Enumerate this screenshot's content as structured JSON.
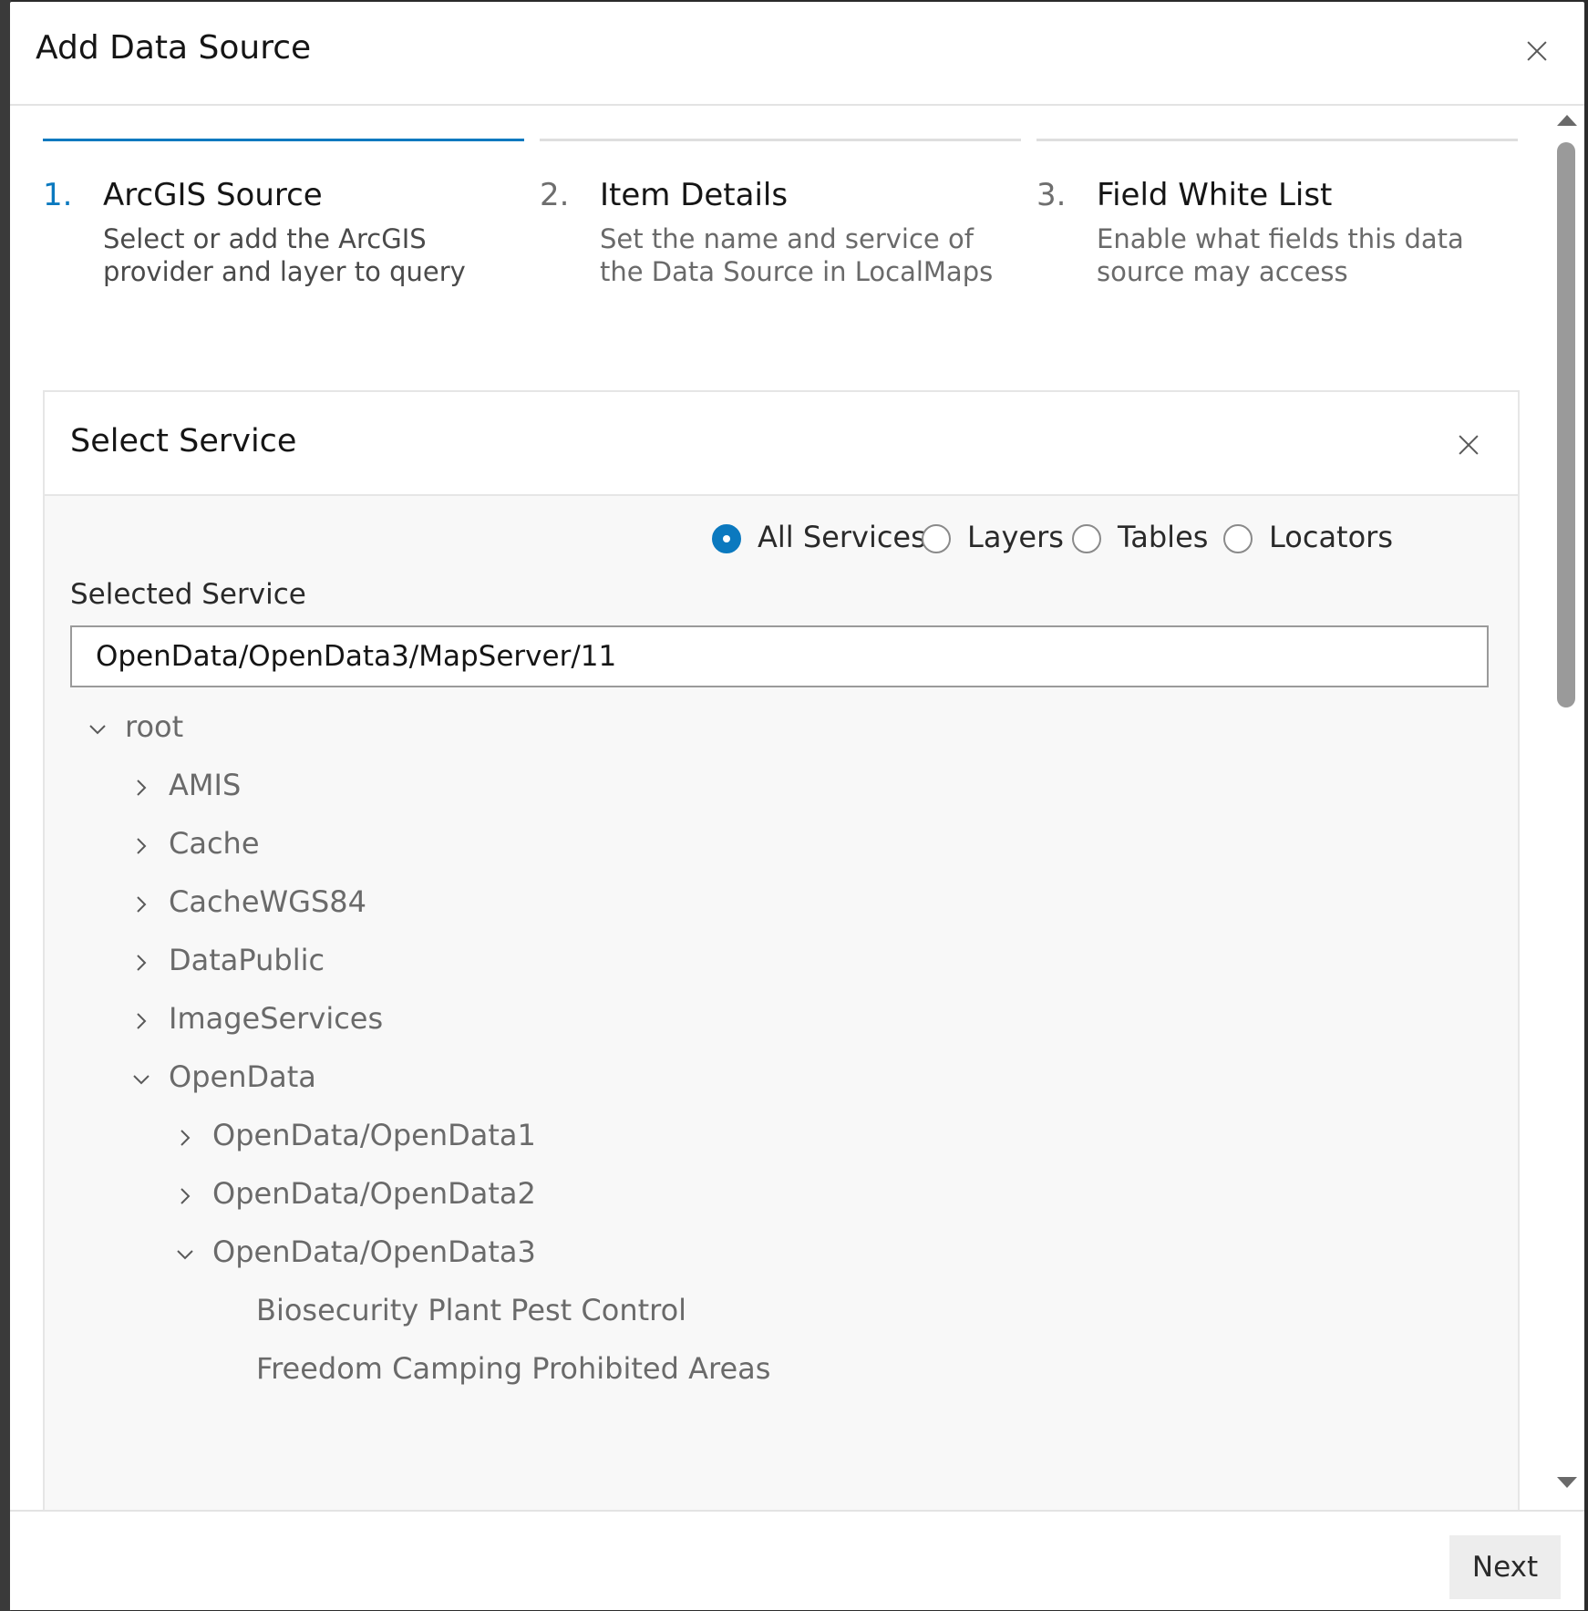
{
  "modal": {
    "title": "Add Data Source",
    "close_icon": "close-icon"
  },
  "steps": [
    {
      "number": "1.",
      "title": "ArcGIS Source",
      "description": "Select or add the ArcGIS provider and layer to query",
      "active": true
    },
    {
      "number": "2.",
      "title": "Item Details",
      "description": "Set the name and service of the Data Source in LocalMaps",
      "active": false
    },
    {
      "number": "3.",
      "title": "Field White List",
      "description": "Enable what fields this data source may access",
      "active": false
    }
  ],
  "panel": {
    "title": "Select Service",
    "close_icon": "close-icon",
    "filter_options": [
      {
        "label": "All Services",
        "checked": true
      },
      {
        "label": "Layers",
        "checked": false
      },
      {
        "label": "Tables",
        "checked": false
      },
      {
        "label": "Locators",
        "checked": false
      }
    ],
    "selected_service_label": "Selected Service",
    "selected_service_value": "OpenData/OpenData3/MapServer/11"
  },
  "tree": [
    {
      "label": "root",
      "depth": 0,
      "chevron": "chevron-down-icon"
    },
    {
      "label": "AMIS",
      "depth": 1,
      "chevron": "chevron-right-icon"
    },
    {
      "label": "Cache",
      "depth": 1,
      "chevron": "chevron-right-icon"
    },
    {
      "label": "CacheWGS84",
      "depth": 1,
      "chevron": "chevron-right-icon"
    },
    {
      "label": "DataPublic",
      "depth": 1,
      "chevron": "chevron-right-icon"
    },
    {
      "label": "ImageServices",
      "depth": 1,
      "chevron": "chevron-right-icon"
    },
    {
      "label": "OpenData",
      "depth": 1,
      "chevron": "chevron-down-icon"
    },
    {
      "label": "OpenData/OpenData1",
      "depth": 2,
      "chevron": "chevron-right-icon"
    },
    {
      "label": "OpenData/OpenData2",
      "depth": 2,
      "chevron": "chevron-right-icon"
    },
    {
      "label": "OpenData/OpenData3",
      "depth": 2,
      "chevron": "chevron-down-icon"
    },
    {
      "label": "Biosecurity Plant Pest Control",
      "depth": 3,
      "chevron": ""
    },
    {
      "label": "Freedom Camping Prohibited Areas",
      "depth": 3,
      "chevron": ""
    }
  ],
  "footer": {
    "next_label": "Next"
  },
  "colors": {
    "accent": "#0b79bf",
    "panel_background": "#f8f8f8",
    "muted_text": "#6a6a6a"
  }
}
